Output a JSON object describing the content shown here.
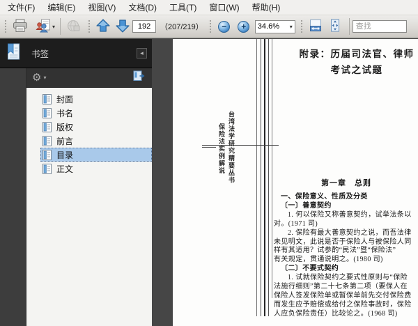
{
  "menubar": {
    "items": [
      {
        "id": "file",
        "label": "文件(F)"
      },
      {
        "id": "edit",
        "label": "编辑(E)"
      },
      {
        "id": "view",
        "label": "视图(V)"
      },
      {
        "id": "document",
        "label": "文档(D)"
      },
      {
        "id": "tools",
        "label": "工具(T)"
      },
      {
        "id": "window",
        "label": "窗口(W)"
      },
      {
        "id": "help",
        "label": "帮助(H)"
      }
    ]
  },
  "toolbar": {
    "page_number": "192",
    "page_count": "（207/219）",
    "zoom_level": "34.6%",
    "search_placeholder": "查找"
  },
  "sidebar": {
    "title": "书签",
    "bookmarks": [
      {
        "id": "cover",
        "label": "封面",
        "selected": false
      },
      {
        "id": "book-name",
        "label": "书名",
        "selected": false
      },
      {
        "id": "copyright",
        "label": "版权",
        "selected": false
      },
      {
        "id": "preface",
        "label": "前言",
        "selected": false
      },
      {
        "id": "toc",
        "label": "目录",
        "selected": true
      },
      {
        "id": "main-text",
        "label": "正文",
        "selected": false
      }
    ]
  },
  "document": {
    "title_line1": "附录：历届司法官、律师",
    "title_line2": "考试之试题",
    "spine_outer": "台湾法学研究精要丛书",
    "spine_inner": "保险法实例解说",
    "chapter_heading": "第一章　总则",
    "body_lines": [
      {
        "t": "一、保险意义、性质及分类",
        "b": true,
        "i": 1
      },
      {
        "t": "〔一〕善意契约",
        "b": true,
        "i": 1
      },
      {
        "t": "1. 何以保险又称善意契约，试举法条以",
        "i": 2
      },
      {
        "t": "对。(1971 司)",
        "i": 0
      },
      {
        "t": "2. 保险有最大善意契约之说，而吾法律",
        "i": 2
      },
      {
        "t": "未见明文，此说是否于保险人与被保险人同",
        "i": 0
      },
      {
        "t": "样有其适用？试参酌“民法”暨“保险法”",
        "i": 0
      },
      {
        "t": "有关规定，贯通说明之。(1980 司)",
        "i": 0
      },
      {
        "t": "〔二〕不要式契约",
        "b": true,
        "i": 1
      },
      {
        "t": "1. 试就保险契约之要式性原则与“保险",
        "i": 2
      },
      {
        "t": "法施行细则”第二十七条第二项（要保人在",
        "i": 0
      },
      {
        "t": "保险人签发保险单或暂保单前先交付保险费",
        "i": 0
      },
      {
        "t": "而发生应予赔偿或给付之保险事故时，保险",
        "i": 0
      },
      {
        "t": "人应负保险责任）比较论之。(1968 司)",
        "i": 0
      }
    ]
  },
  "icons": {
    "gear": "⚙",
    "caret_down": "▾",
    "collapse_left": "◂",
    "zoom_out_glyph": "−",
    "zoom_in_glyph": "+"
  },
  "colors": {
    "selection": "#a9c9ea",
    "panel_dark": "#1d1d1d",
    "arrow_blue": "#4a93d4"
  }
}
